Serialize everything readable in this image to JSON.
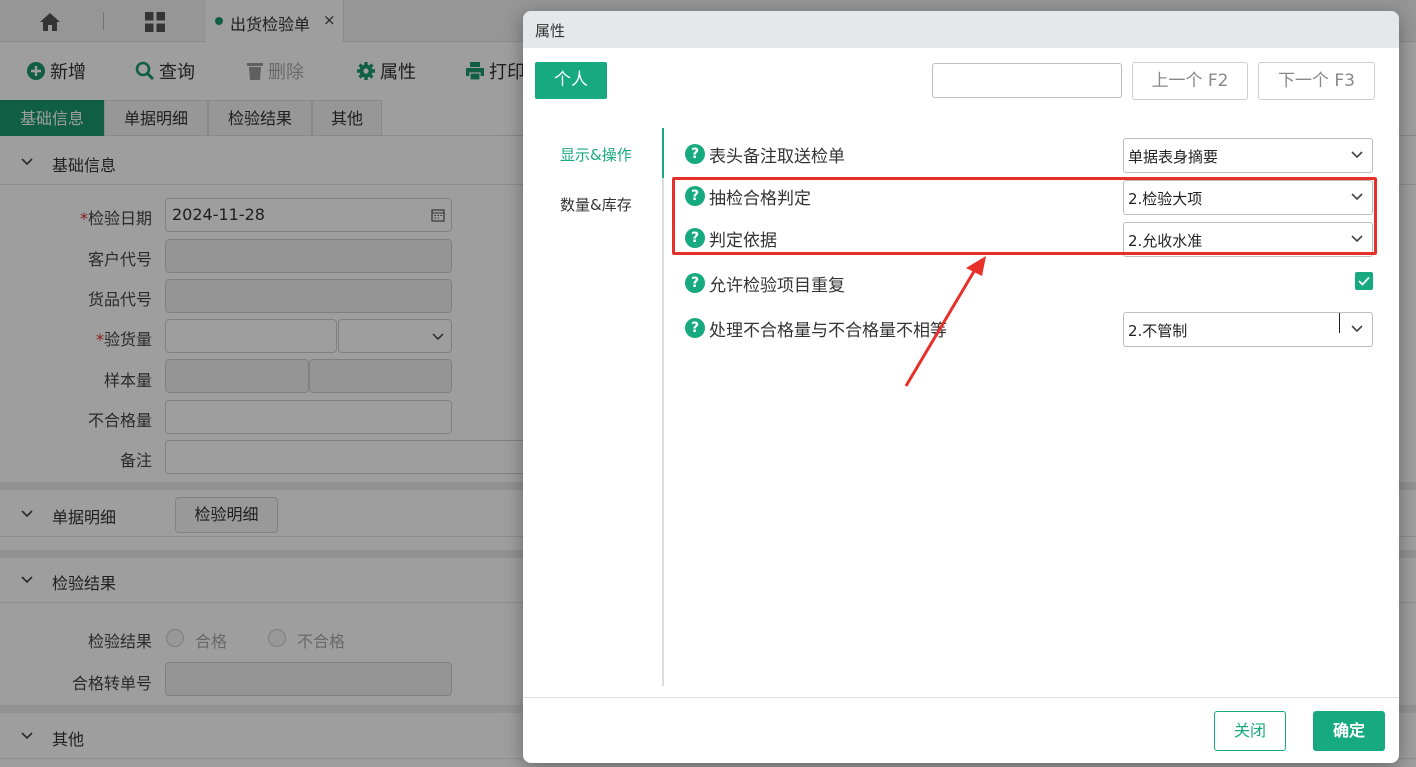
{
  "tabbar": {
    "doc_tab": "出货检验单",
    "close_glyph": "×"
  },
  "toolbar": {
    "add": "新增",
    "query": "查询",
    "delete": "删除",
    "props": "属性",
    "print": "打印"
  },
  "section_tabs": [
    "基础信息",
    "单据明细",
    "检验结果",
    "其他"
  ],
  "sections": {
    "basic": "基础信息",
    "detail": "单据明细",
    "result": "检验结果",
    "other": "其他"
  },
  "form": {
    "date_label": "检验日期",
    "date_value": "2024-11-28",
    "customer_label": "客户代号",
    "goods_label": "货品代号",
    "qty_label": "验货量",
    "sample_label": "样本量",
    "defect_label": "不合格量",
    "remark_label": "备注",
    "detail_btn": "检验明细",
    "result_label": "检验结果",
    "pass": "合格",
    "fail": "不合格",
    "transfer_label": "合格转单号",
    "required": "*"
  },
  "dialog": {
    "title": "属性",
    "personal_btn": "个人",
    "prev_btn": "上一个 F2",
    "next_btn": "下一个 F3",
    "nav": [
      "显示&操作",
      "数量&库存"
    ],
    "rows": [
      {
        "label": "表头备注取送检单",
        "value": "单据表身摘要"
      },
      {
        "label": "抽检合格判定",
        "value": "2.检验大项"
      },
      {
        "label": "判定依据",
        "value": "2.允收水准"
      },
      {
        "label": "允许检验项目重复",
        "checked": true
      },
      {
        "label": "处理不合格量与不合格量不相等",
        "value": "2.不管制"
      }
    ],
    "close_btn": "关闭",
    "ok_btn": "确定"
  },
  "colors": {
    "accent": "#17a97f",
    "highlight": "#e8302a"
  }
}
